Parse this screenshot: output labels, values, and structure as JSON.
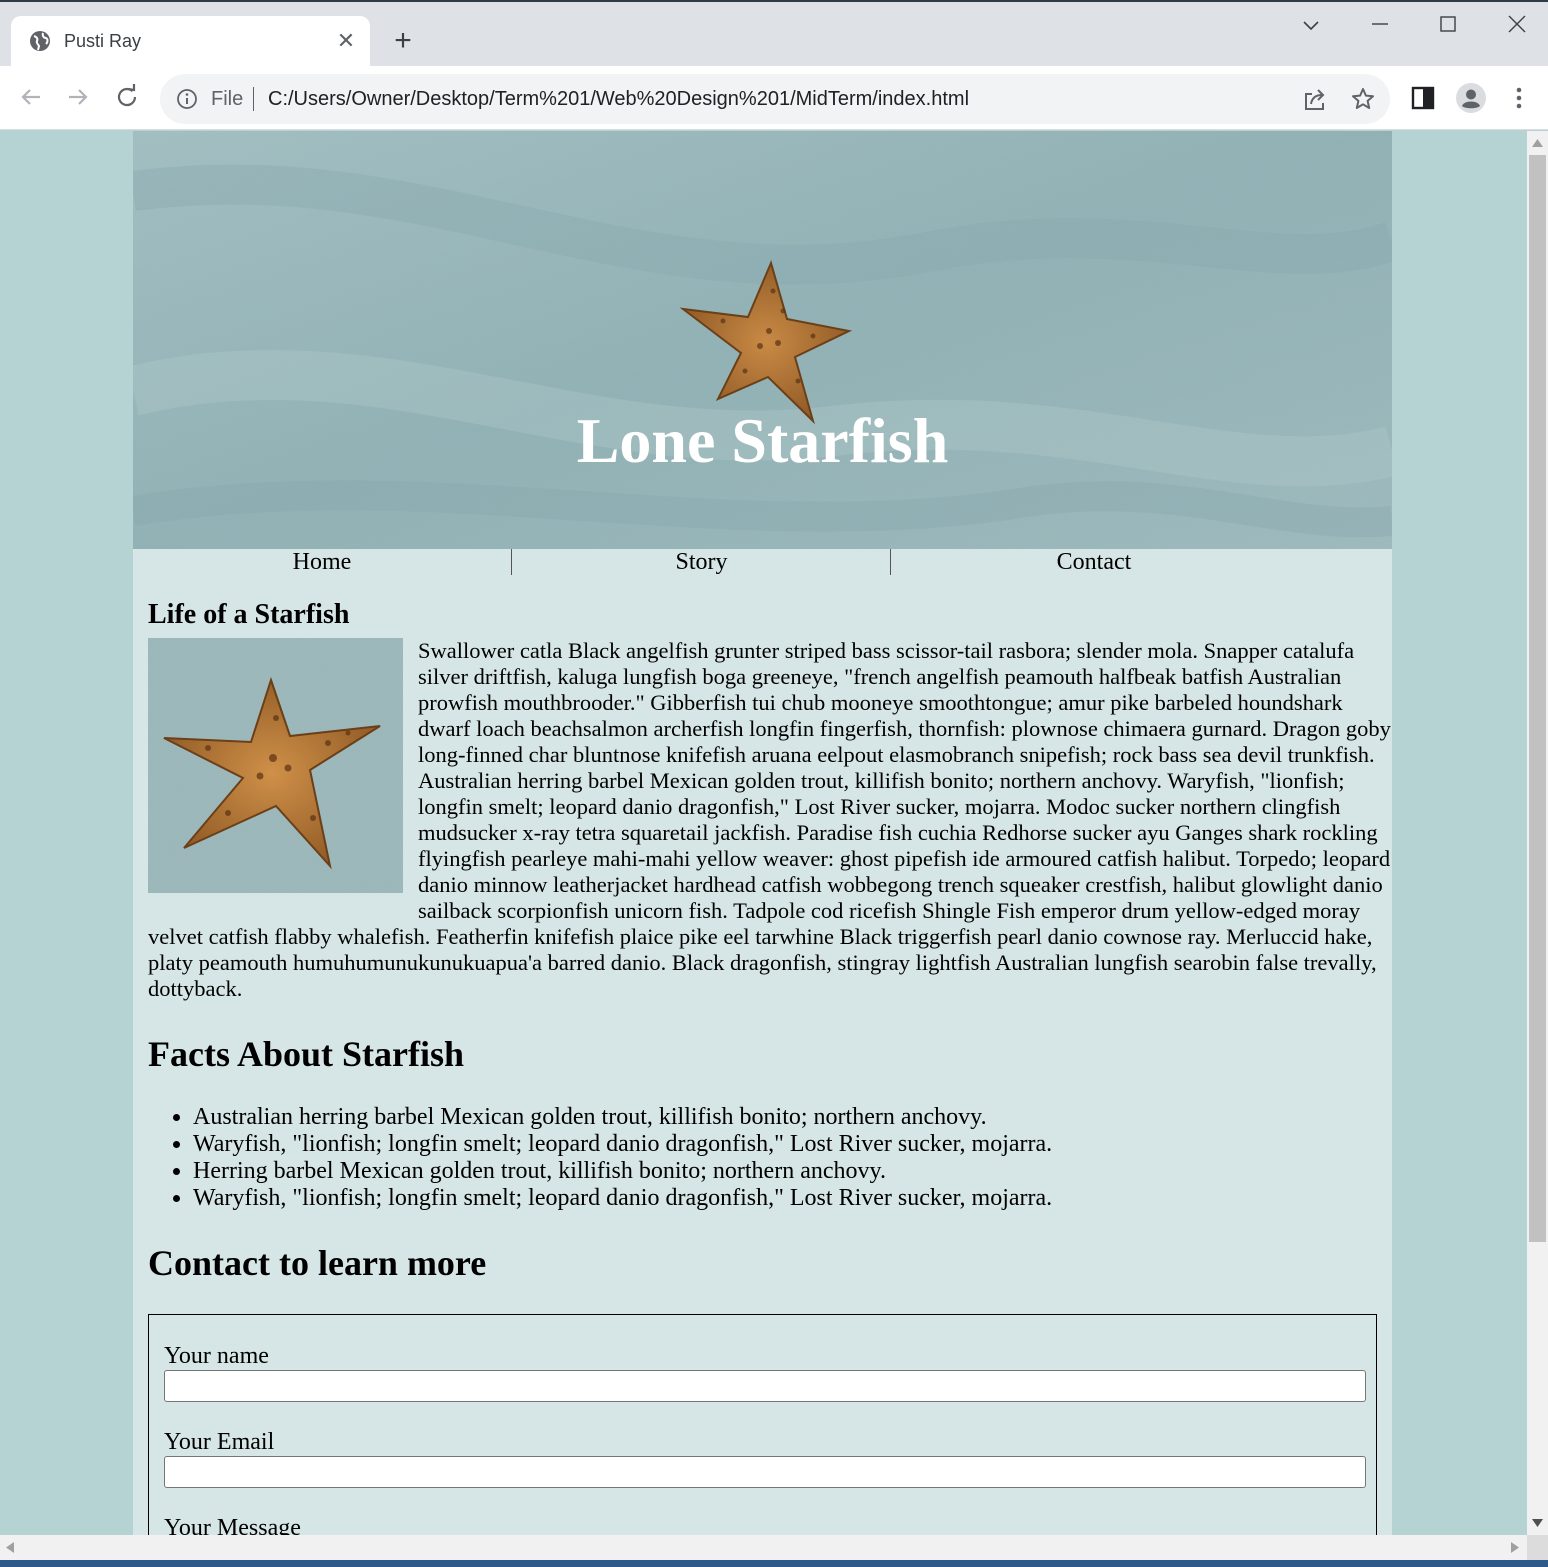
{
  "browser": {
    "tab_title": "Pusti Ray",
    "tab_close": "✕",
    "new_tab": "+",
    "omnibox_scheme": "File",
    "url": "C:/Users/Owner/Desktop/Term%201/Web%20Design%201/MidTerm/index.html"
  },
  "page": {
    "banner_title": "Lone Starfish",
    "nav": [
      "Home",
      "Story",
      "Contact"
    ],
    "life_heading": "Life of a Starfish",
    "life_text": "Swallower catla Black angelfish grunter striped bass scissor-tail rasbora; slender mola. Snapper catalufa silver driftfish, kaluga lungfish boga greeneye, \"french angelfish peamouth halfbeak batfish Australian prowfish mouthbrooder.\" Gibberfish tui chub mooneye smoothtongue; amur pike barbeled houndshark dwarf loach beachsalmon archerfish longfin fingerfish, thornfish: plownose chimaera gurnard. Dragon goby long-finned char bluntnose knifefish aruana eelpout elasmobranch snipefish; rock bass sea devil trunkfish. Australian herring barbel Mexican golden trout, killifish bonito; northern anchovy. Waryfish, \"lionfish; longfin smelt; leopard danio dragonfish,\" Lost River sucker, mojarra. Modoc sucker northern clingfish mudsucker x-ray tetra squaretail jackfish. Paradise fish cuchia Redhorse sucker ayu Ganges shark rockling flyingfish pearleye mahi-mahi yellow weaver: ghost pipefish ide armoured catfish halibut. Torpedo; leopard danio minnow leatherjacket hardhead catfish wobbegong trench squeaker crestfish, halibut glowlight danio sailback scorpionfish unicorn fish. Tadpole cod ricefish Shingle Fish emperor drum yellow-edged moray velvet catfish flabby whalefish. Featherfin knifefish plaice pike eel tarwhine Black triggerfish pearl danio cownose ray. Merluccid hake, platy peamouth humuhumunukunukuapua'a barred danio. Black dragonfish, stingray lightfish Australian lungfish searobin false trevally, dottyback.",
    "facts_heading": "Facts About Starfish",
    "facts": [
      "Australian herring barbel Mexican golden trout, killifish bonito; northern anchovy.",
      "Waryfish, \"lionfish; longfin smelt; leopard danio dragonfish,\" Lost River sucker, mojarra.",
      "Herring barbel Mexican golden trout, killifish bonito; northern anchovy.",
      "Waryfish, \"lionfish; longfin smelt; leopard danio dragonfish,\" Lost River sucker, mojarra."
    ],
    "contact_heading": "Contact to learn more",
    "form": {
      "name_label": "Your name",
      "name_value": "",
      "email_label": "Your Email",
      "email_value": "",
      "message_label": "Your Message"
    }
  },
  "icons": [
    "globe-icon",
    "close-icon",
    "plus-icon",
    "chevron-down-icon",
    "minimize-icon",
    "maximize-icon",
    "window-close-icon",
    "back-arrow-icon",
    "forward-arrow-icon",
    "reload-icon",
    "info-icon",
    "share-icon",
    "star-icon",
    "side-panel-icon",
    "profile-icon",
    "more-vert-icon"
  ],
  "colors": {
    "page_bg": "#b5d3d3",
    "content_bg": "#d6e5e6",
    "banner_sand": "#8fb2b6",
    "starfish": "#b5773a"
  }
}
